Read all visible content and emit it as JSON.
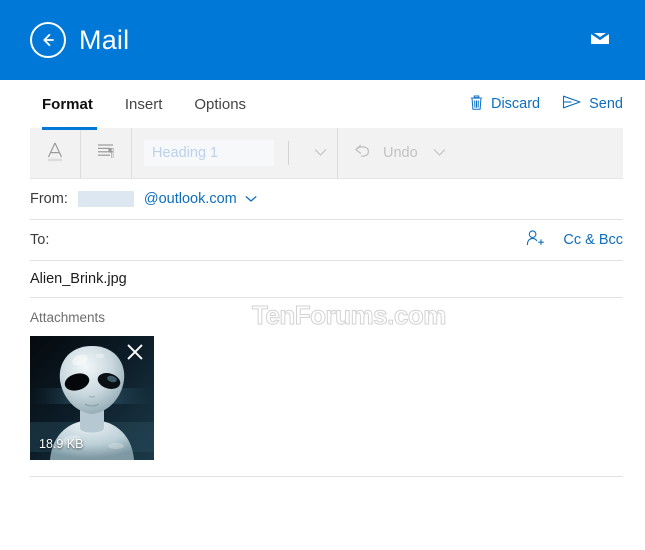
{
  "titlebar": {
    "app_title": "Mail",
    "back_icon": "back-arrow-circle-icon",
    "envelope_icon": "envelope-icon",
    "background_color": "#0078d7"
  },
  "commandbar": {
    "tabs": [
      {
        "label": "Format",
        "active": true
      },
      {
        "label": "Insert",
        "active": false
      },
      {
        "label": "Options",
        "active": false
      }
    ],
    "actions": [
      {
        "label": "Discard",
        "icon": "trash-icon"
      },
      {
        "label": "Send",
        "icon": "send-paper-plane-icon"
      }
    ],
    "accent_color": "#0078d7",
    "link_color": "#0d6ebf"
  },
  "ribbon": {
    "font_button_icon": "font-a-underline-icon",
    "paragraph_button_icon": "paragraph-pilcrow-icon",
    "style_value": "Heading 1",
    "style_chevron_icon": "chevron-down-icon",
    "undo_label": "Undo",
    "undo_icon": "undo-arrow-icon",
    "undo_chevron_icon": "chevron-down-icon",
    "background_color": "#f2f2f2"
  },
  "compose": {
    "from_label": "From:",
    "from_redacted": "",
    "from_domain": "@outlook.com",
    "from_chevron_icon": "chevron-down-icon",
    "to_label": "To:",
    "to_value": "",
    "add_contact_icon": "person-add-icon",
    "cc_bcc_label": "Cc & Bcc",
    "subject_value": "Alien_Brink.jpg"
  },
  "attachments": {
    "section_label": "Attachments",
    "items": [
      {
        "name": "Alien_Brink.jpg",
        "size_label": "18.9 KB",
        "remove_icon": "close-x-icon",
        "thumbnail": "alien-face-image"
      }
    ]
  },
  "watermark": {
    "text": "TenForums.com"
  }
}
